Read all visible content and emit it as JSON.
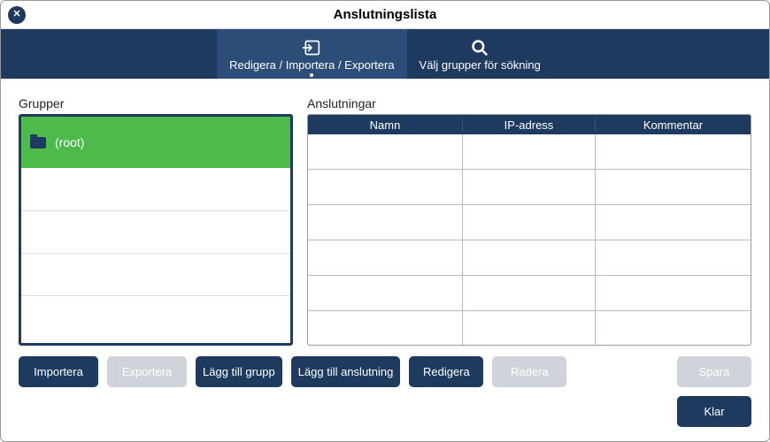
{
  "window": {
    "title": "Anslutningslista"
  },
  "tabs": {
    "edit_import_export": "Redigera / Importera / Exportera",
    "select_groups": "Välj grupper för sökning"
  },
  "groups": {
    "label": "Grupper",
    "root_name": "(root)"
  },
  "connections": {
    "label": "Anslutningar",
    "columns": {
      "name": "Namn",
      "ip": "IP-adress",
      "comment": "Kommentar"
    }
  },
  "buttons": {
    "import": "Importera",
    "export": "Exportera",
    "add_group": "Lägg till grupp",
    "add_connection": "Lägg till anslutning",
    "edit": "Redigera",
    "delete": "Radera",
    "save": "Spara",
    "done": "Klar"
  }
}
